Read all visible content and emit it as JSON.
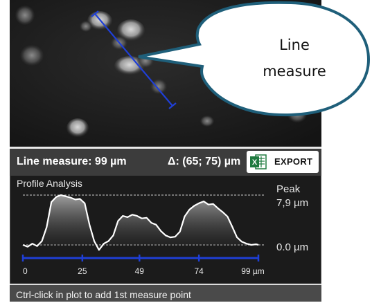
{
  "callout": {
    "line1": "Line",
    "line2": "measure"
  },
  "measure_bar": {
    "measure_text": "Line measure: 99 µm",
    "delta_text": "Δ: (65; 75) µm",
    "export_label": "EXPORT",
    "export_icon": "excel-icon"
  },
  "profile": {
    "title": "Profile Analysis",
    "peak_label": "Peak",
    "peak_value": "7,9 µm",
    "baseline_label": "0.0 µm",
    "axis_ticks": [
      "0",
      "25",
      "49",
      "74",
      "99 µm"
    ],
    "chart_data": {
      "type": "line",
      "x": [
        0,
        2,
        4,
        6,
        8,
        10,
        12,
        14,
        16,
        18,
        20,
        22,
        24,
        26,
        28,
        30,
        32,
        34,
        36,
        38,
        40,
        42,
        44,
        46,
        48,
        50,
        52,
        54,
        56,
        58,
        60,
        62,
        64,
        66,
        68,
        70,
        72,
        74,
        76,
        78,
        80,
        82,
        84,
        86,
        88,
        90,
        92,
        94,
        96,
        98,
        99
      ],
      "values": [
        0.0,
        -0.3,
        0.2,
        -0.2,
        0.6,
        2.8,
        6.8,
        7.6,
        7.9,
        7.7,
        7.5,
        7.2,
        7.3,
        6.6,
        3.2,
        0.6,
        -0.8,
        0.2,
        0.6,
        1.5,
        3.8,
        4.6,
        4.4,
        4.8,
        4.6,
        4.2,
        4.3,
        3.5,
        3.2,
        2.2,
        1.5,
        1.2,
        1.3,
        2.1,
        4.5,
        5.6,
        6.2,
        6.6,
        6.9,
        6.4,
        6.5,
        5.8,
        5.2,
        4.5,
        2.9,
        1.2,
        0.5,
        0.2,
        0.0,
        0.1,
        0.0
      ],
      "xlim": [
        0,
        99
      ],
      "ylim": [
        -0.8,
        7.9
      ]
    }
  },
  "status": {
    "text": "Ctrl-click in plot to add 1st measure point"
  },
  "colors": {
    "measure_line": "#1f3fd6",
    "callout_border": "#1f5f7a",
    "excel_green": "#1f7a3f"
  }
}
